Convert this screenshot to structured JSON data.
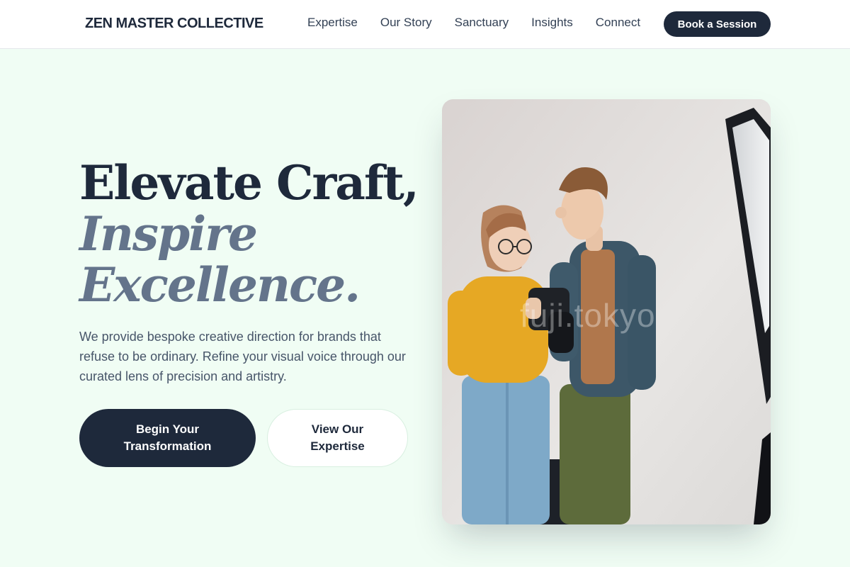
{
  "header": {
    "logo": "ZEN MASTER COLLECTIVE",
    "nav": [
      "Expertise",
      "Our Story",
      "Sanctuary",
      "Insights",
      "Connect"
    ],
    "cta": "Book a Session"
  },
  "hero": {
    "headline_line1": "Elevate Craft,",
    "headline_line2": "Inspire",
    "headline_line3": "Excellence.",
    "description": "We provide bespoke creative direction for brands that refuse to be ordinary. Refine your visual voice through our curated lens of precision and artistry.",
    "primary_button": "Begin Your Transformation",
    "secondary_button": "View Our Expertise",
    "image_watermark": "fuji.tokyo"
  },
  "colors": {
    "background": "#f0fdf4",
    "primary": "#1e293b",
    "accent_muted": "#64748b"
  }
}
